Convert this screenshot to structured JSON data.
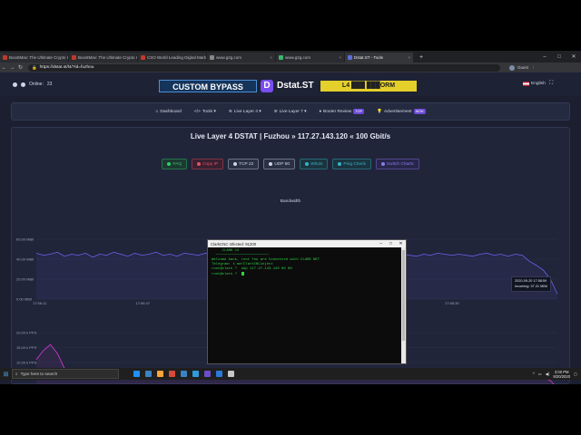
{
  "browser": {
    "tabs": [
      {
        "title": "BoostMav: The Ultimate Crypto C",
        "color": "#c0392b"
      },
      {
        "title": "BoostMav: The Ultimate Crypto C",
        "color": "#c0392b"
      },
      {
        "title": "CSO World Leading Digital Marke",
        "color": "#c0392b"
      },
      {
        "title": "www.g2g.com",
        "color": "#888888"
      },
      {
        "title": "www.g2g.com",
        "color": "#3cb371"
      },
      {
        "title": "Dstat.ST - Tools",
        "color": "#5b6fd6"
      }
    ],
    "url": "https://dstat.st/l4/?id=fuzhou",
    "profile": "Guest"
  },
  "site": {
    "online_label": "Online:",
    "online_count": "23",
    "banner": "CUSTOM BYPASS",
    "logo_letter": "D",
    "logo": "Dstat.ST",
    "promo": "L4 ███ ███ORM",
    "language": "English",
    "menu": [
      {
        "icon": "⌂",
        "label": "Dashboard"
      },
      {
        "icon": "</>",
        "label": "Tools ▾"
      },
      {
        "icon": "≋",
        "label": "Live Layer 4 ▾"
      },
      {
        "icon": "≋",
        "label": "Live Layer 7 ▾"
      },
      {
        "icon": "♦",
        "label": "Booter Review",
        "badge": "TOP"
      },
      {
        "icon": "💡",
        "label": "Advertisement",
        "badge": "NEW"
      }
    ],
    "title": "Live Layer 4 DSTAT | Fuzhou » 117.27.143.120 « 100 Gbit/s",
    "buttons": [
      {
        "label": "FAQ",
        "color": "#2ecc71",
        "bg": "#1d3a31"
      },
      {
        "label": "Copy IP",
        "color": "#e0526b",
        "bg": "#3a2030"
      },
      {
        "label": "TCP 22",
        "color": "#cfd6e6",
        "bg": "#2a3046"
      },
      {
        "label": "UDP 80",
        "color": "#cfd6e6",
        "bg": "#2a3046"
      },
      {
        "label": "Whois",
        "color": "#36b3c9",
        "bg": "#1b3540"
      },
      {
        "label": "Ping Check",
        "color": "#36b3c9",
        "bg": "#1b3540"
      },
      {
        "label": "Switch Charts",
        "color": "#8c7be8",
        "bg": "#28264a"
      }
    ],
    "bandwidth_label": "Bandwidth"
  },
  "chart_data": [
    {
      "type": "line",
      "title": "Bandwidth",
      "ylabel": "",
      "y_ticks": [
        "60.00 MBit",
        "40.00 MBit",
        "20.00 MBit",
        "0.00 MBit"
      ],
      "ylim": [
        0,
        60
      ],
      "x_ticks": [
        "17:56:11",
        "17:56:47",
        "17:57:23",
        "17:57:59",
        "17:58:35"
      ],
      "color": "#6f5ff0",
      "series": [
        {
          "values": [
            46,
            44,
            45,
            47,
            43,
            45,
            44,
            46,
            42,
            45,
            44,
            47,
            45,
            43,
            46,
            44,
            45,
            47,
            44,
            45,
            43,
            46,
            45,
            44,
            46,
            45,
            43,
            44,
            46,
            45,
            44,
            45,
            47,
            44,
            43,
            45,
            46,
            44,
            45,
            44,
            46,
            45,
            43,
            44,
            45,
            46,
            44,
            45,
            43,
            45,
            44,
            46,
            45,
            44,
            43,
            45,
            44,
            46,
            45,
            44,
            45,
            44,
            43,
            45,
            46,
            44,
            45,
            43,
            45,
            44,
            38,
            34,
            29,
            20,
            5
          ]
        }
      ],
      "tooltip": {
        "time": "2020-09-20 17:58:59",
        "label": "Incoming",
        "value": "37.21 MBit"
      }
    },
    {
      "type": "line",
      "y_ticks": [
        "20.00 k PPS",
        "15.00 k PPS",
        "10.00 k PPS",
        "5.00 k PPS",
        "0.00 PPS"
      ],
      "ylim": [
        0,
        20
      ],
      "x_ticks": [
        "17:56:11",
        "17:56:47",
        "17:57:23",
        "17:57:59",
        "17:58:35"
      ],
      "color": "#d63ad6",
      "series": [
        {
          "values": [
            11,
            14,
            16,
            13,
            8,
            6,
            5.6,
            5.2,
            5.8,
            5.1,
            5.5,
            5.0,
            5.4,
            5.3,
            5.7,
            5.1,
            5.6,
            5.2,
            5.5,
            5.0,
            5.4,
            5.6,
            5.1,
            5.3,
            5.5,
            5.2,
            5.0,
            5.4,
            5.3,
            5.6,
            5.1,
            5.5,
            5.2,
            5.4,
            5.0,
            5.3,
            5.6,
            5.2,
            5.4,
            5.1,
            5.5,
            5.3,
            5.0,
            5.4,
            5.2,
            5.6,
            5.1,
            5.3,
            5.5,
            5.2,
            5.4,
            5.0,
            5.3,
            5.6,
            5.2,
            5.4,
            5.1,
            5.5,
            5.3,
            5.0,
            5.4,
            5.2,
            5.5,
            5.1,
            5.3,
            5.6,
            5.2,
            5.4,
            5.0,
            5.3,
            5.5,
            5.2,
            4.8,
            4.0,
            1.5
          ]
        }
      ]
    }
  ],
  "terminal": {
    "title": "ClarkCNC Infected: 91200",
    "lines": [
      "",
      "",
      "",
      "     CLARK C2",
      "",
      "  ─────────────────────────",
      "",
      "Welcome back, root You are Connected with CLARK NET",
      "",
      "Telegram: t.me/ClarkCNCinject",
      "root@clark ?  udp 117.27.143.120 80 60",
      "",
      "root@clark ?  "
    ]
  },
  "taskbar": {
    "search_placeholder": "Type here to search",
    "time": "3:00 PM",
    "date": "9/20/2020",
    "apps": [
      "#1e90ff",
      "#3b82c4",
      "#ffa43b",
      "#d84a3a",
      "#3b82c4",
      "#2d9bdc",
      "#6a4fc8",
      "#2a7ad8",
      "#c7c7c7"
    ]
  }
}
